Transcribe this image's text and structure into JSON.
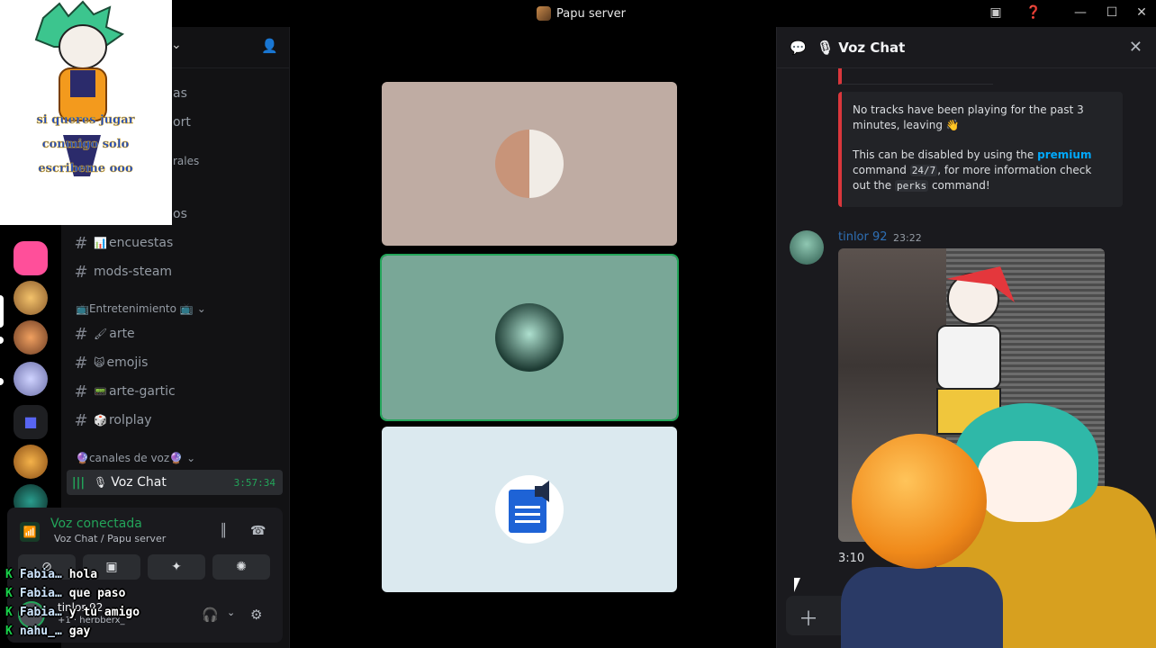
{
  "window": {
    "title": "Papu server"
  },
  "sidebar": {
    "partial_items": [
      "as",
      "ort",
      "rales",
      "os"
    ],
    "channels_top": [
      {
        "emoji": "📊",
        "name": "encuestas"
      },
      {
        "emoji": "",
        "name": "mods-steam"
      }
    ],
    "category_entertainment": "📺Entretenimiento 📺",
    "channels_entertainment": [
      {
        "emoji": "🖌",
        "name": "arte"
      },
      {
        "emoji": "🙀",
        "name": "emojis"
      },
      {
        "emoji": "📟",
        "name": "arte-gartic"
      },
      {
        "emoji": "🎲",
        "name": "rolplay"
      }
    ],
    "category_voice": "🔮canales de voz🔮",
    "voice_channel": {
      "name": "Voz Chat",
      "timer": "3:57:34"
    }
  },
  "voice_panel": {
    "status": "Voz conectada",
    "location": "Voz Chat / Papu server",
    "user_name": "tinlor 92",
    "user_sub": "+1 · herbberx_"
  },
  "overlay_chat": [
    {
      "name": "Fabia…",
      "text": "hola"
    },
    {
      "name": "Fabia…",
      "text": "que paso"
    },
    {
      "name": "Fabia…",
      "text": "y tu amigo"
    },
    {
      "name": "nahu_…",
      "text": "gay"
    }
  ],
  "sticker": {
    "caption": "si queres jugar conmigo solo escribeme ooo"
  },
  "stage": {
    "tiles": [
      {
        "bg": "#bfaca3",
        "speaking": false
      },
      {
        "bg": "#79a797",
        "speaking": true
      },
      {
        "bg": "#dbe9ef",
        "speaking": false
      }
    ]
  },
  "chat": {
    "channel": "Voz Chat",
    "embed": {
      "line1": "No tracks have been playing for the past 3 minutes, leaving 👋",
      "line2_pre": "This can be disabled by using the",
      "line2_link": "premium",
      "line2_cmd": "24/7",
      "line2_mid": "command",
      "line2_post": ", for more information check out the",
      "line2_cmd2": "perks",
      "line2_end": "command!"
    },
    "message": {
      "author": "tinlor 92",
      "time": "23:22",
      "duration": "3:10"
    }
  }
}
